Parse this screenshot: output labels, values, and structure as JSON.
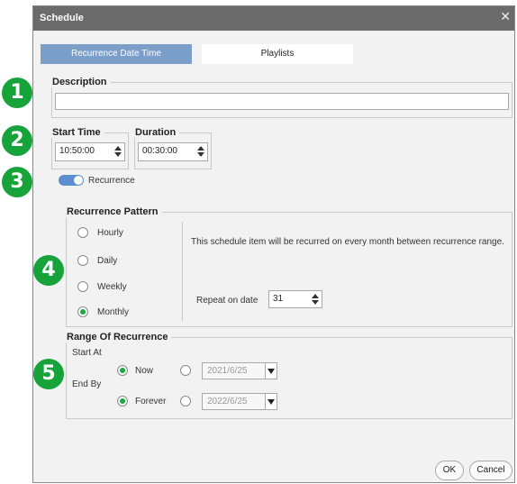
{
  "dialog": {
    "title": "Schedule",
    "close_glyph": "✕"
  },
  "tabs": [
    {
      "label": "Recurrence Date Time",
      "active": true
    },
    {
      "label": "Playlists",
      "active": false
    }
  ],
  "description": {
    "label": "Description",
    "value": ""
  },
  "start_time": {
    "label": "Start Time",
    "value": "10:50:00"
  },
  "duration": {
    "label": "Duration",
    "value": "00:30:00"
  },
  "recurrence_toggle": {
    "label": "Recurrence",
    "on": true
  },
  "pattern": {
    "label": "Recurrence Pattern",
    "options": [
      {
        "label": "Hourly",
        "checked": false
      },
      {
        "label": "Daily",
        "checked": false
      },
      {
        "label": "Weekly",
        "checked": false
      },
      {
        "label": "Monthly",
        "checked": true
      }
    ],
    "info": "This schedule item will be recurred on every month between recurrence range.",
    "repeat_label": "Repeat on date",
    "repeat_value": "31"
  },
  "range": {
    "label": "Range Of Recurrence",
    "start_label": "Start At",
    "start_now_label": "Now",
    "start_date": "2021/6/25",
    "end_label": "End By",
    "end_forever_label": "Forever",
    "end_date": "2022/6/25"
  },
  "buttons": {
    "ok": "OK",
    "cancel": "Cancel"
  },
  "markers": [
    "1",
    "2",
    "3",
    "4",
    "5"
  ],
  "colors": {
    "marker": "#16a33a",
    "tab_active": "#7c9fca",
    "toggle": "#5b8fcb",
    "titlebar": "#6b6b6b"
  }
}
